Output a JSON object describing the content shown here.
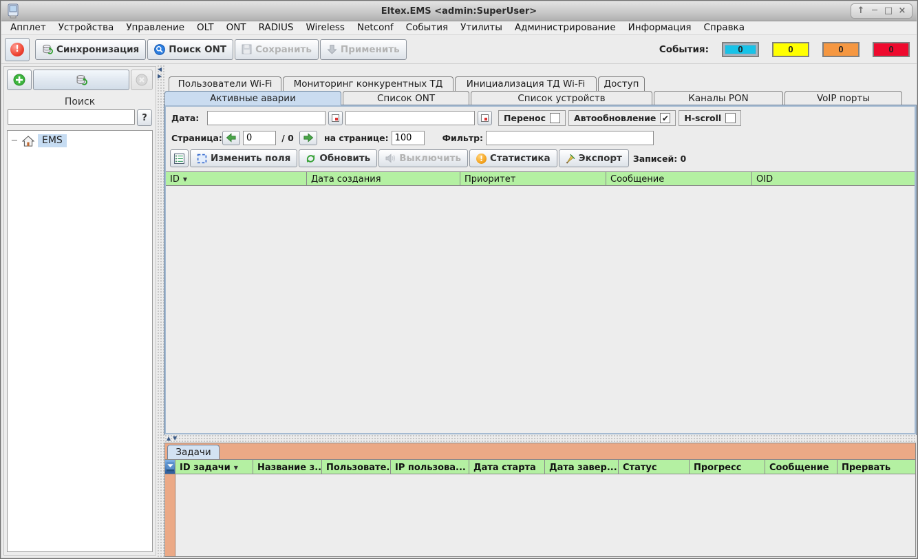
{
  "titlebar": {
    "title": "Eltex.EMS <admin:SuperUser>",
    "controls": {
      "shade": "↑",
      "minimize": "─",
      "maximize": "□",
      "close": "×"
    }
  },
  "menu": {
    "items": [
      "Апплет",
      "Устройства",
      "Управление",
      "OLT",
      "ONT",
      "RADIUS",
      "Wireless",
      "Netconf",
      "События",
      "Утилиты",
      "Администрирование",
      "Информация",
      "Справка"
    ]
  },
  "toolbar": {
    "sync_label": "Синхронизация",
    "search_ont_label": "Поиск ONT",
    "save_label": "Сохранить",
    "apply_label": "Применить",
    "alarm_glyph": "!",
    "events_label": "События:",
    "events": [
      {
        "severity": "info",
        "value": "0",
        "color": "#17c3e8"
      },
      {
        "severity": "warning",
        "value": "0",
        "color": "#ffff00"
      },
      {
        "severity": "major",
        "value": "0",
        "color": "#f59741"
      },
      {
        "severity": "critical",
        "value": "0",
        "color": "#ee0a2e"
      }
    ]
  },
  "sidebar": {
    "search_label": "Поиск",
    "search_value": "",
    "help_label": "?",
    "tree": {
      "expand_glyph": "−",
      "root_label": "EMS"
    }
  },
  "tabs": {
    "row1": [
      "Пользователи Wi-Fi",
      "Мониторинг конкурентных ТД",
      "Инициализация ТД Wi-Fi",
      "Доступ"
    ],
    "row2": [
      "Активные аварии",
      "Список ONT",
      "Список устройств",
      "Каналы PON",
      "VoIP порты"
    ],
    "selected": "Активные аварии"
  },
  "filters": {
    "date_label": "Дата:",
    "date_from": "",
    "date_to": "",
    "wrap_label": "Перенос",
    "autorefresh_label": "Автообновление",
    "autorefresh_check": "✔",
    "hscroll_label": "H-scroll",
    "page_label": "Страница:",
    "page_value": "0",
    "page_total_label": "/ 0",
    "per_page_label": "на странице:",
    "per_page_value": "100",
    "filter_label": "Фильтр:",
    "filter_value": ""
  },
  "actions": {
    "edit_fields_label": "Изменить поля",
    "refresh_label": "Обновить",
    "disable_label": "Выключить",
    "stats_label": "Статистика",
    "stats_glyph": "!",
    "export_label": "Экспорт",
    "records_label": "Записей: 0"
  },
  "alarms_table": {
    "sort_indicator": "▼",
    "columns": [
      "ID",
      "Дата создания",
      "Приоритет",
      "Сообщение",
      "OID"
    ],
    "rows": []
  },
  "tasks": {
    "tab_label": "Задачи",
    "sort_indicator": "▼",
    "columns": [
      "ID задачи",
      "Название з...",
      "Пользовате...",
      "IP пользова...",
      "Дата старта",
      "Дата завер...",
      "Статус",
      "Прогресс",
      "Сообщение",
      "Прервать"
    ],
    "rows": []
  },
  "splitters": {
    "up": "▲",
    "down": "▼",
    "left": "◀",
    "right": "▶"
  }
}
